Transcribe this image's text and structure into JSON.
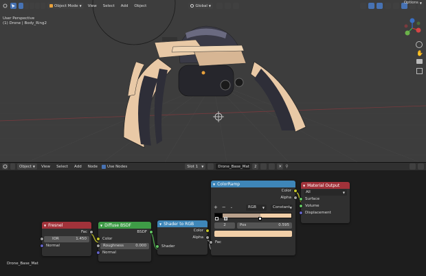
{
  "viewport_header": {
    "mode": "Object Mode",
    "menus": [
      "View",
      "Select",
      "Add",
      "Object"
    ],
    "transform": "Global",
    "options": "Options"
  },
  "viewport": {
    "view_name": "User Perspective",
    "object_info": "(1) Drone | Body_Ring2"
  },
  "node_header": {
    "editor_type": "Object",
    "menus": [
      "View",
      "Select",
      "Add",
      "Node"
    ],
    "use_nodes": "Use Nodes",
    "slot": "Slot 1",
    "material": "Drone_Base_Mat",
    "user_count": "2"
  },
  "node_editor": {
    "material_label": "Drone_Base_Mat"
  },
  "nodes": {
    "fresnel": {
      "title": "Fresnel",
      "out_fac": "Fac",
      "ior_label": "IOR",
      "ior_value": "1.450",
      "normal": "Normal"
    },
    "diffuse": {
      "title": "Diffuse BSDF",
      "out_bsdf": "BSDF",
      "color": "Color",
      "roughness_label": "Roughness",
      "roughness_value": "0.000",
      "normal": "Normal"
    },
    "shader_to_rgb": {
      "title": "Shader to RGB",
      "out_color": "Color",
      "out_alpha": "Alpha",
      "in_shader": "Shader"
    },
    "colorramp": {
      "title": "ColorRamp",
      "out_color": "Color",
      "out_alpha": "Alpha",
      "add": "+",
      "remove": "−",
      "mode": "RGB",
      "interpolation": "Constant",
      "index": "2",
      "pos_label": "Pos",
      "pos_value": "0.595",
      "in_fac": "Fac"
    },
    "material_output": {
      "title": "Material Output",
      "target": "All",
      "surface": "Surface",
      "volume": "Volume",
      "displacement": "Displacement"
    }
  },
  "colors": {
    "input_header": "#a1323a",
    "shader_header": "#3e9b46",
    "converter_header": "#3e86b8",
    "output_header": "#a1323a",
    "ramp_light": "#f2cfa8",
    "accent": "#4772b3"
  }
}
